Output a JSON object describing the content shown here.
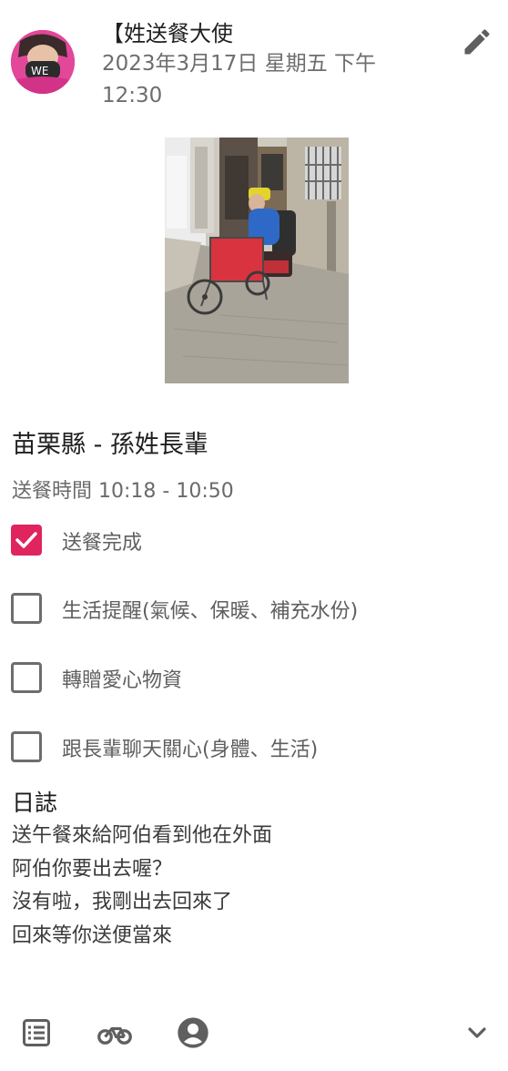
{
  "post": {
    "author": "【姓送餐大使",
    "timestamp": "2023年3月17日 星期五 下午 12:30",
    "avatar_text": "WE"
  },
  "content": {
    "title": "苗栗縣 - 孫姓長輩",
    "delivery_time": "送餐時間 10:18 - 10:50"
  },
  "checklist": [
    {
      "label": "送餐完成",
      "checked": true
    },
    {
      "label": "生活提醒(氣候、保暖、補充水份)",
      "checked": false
    },
    {
      "label": "轉贈愛心物資",
      "checked": false
    },
    {
      "label": "跟長輩聊天關心(身體、生活)",
      "checked": false
    }
  ],
  "log": {
    "heading": "日誌",
    "lines": [
      "送午餐來給阿伯看到他在外面",
      "阿伯你要出去喔？",
      "沒有啦，我剛出去回來了",
      "回來等你送便當來"
    ]
  },
  "icons": {
    "edit": "pencil-icon",
    "bottom": [
      "list-icon",
      "bicycle-icon",
      "account-icon",
      "chevron-down-icon"
    ]
  },
  "colors": {
    "accent": "#e0245e",
    "muted_text": "#6d6d6d",
    "icon_gray": "#5f5f5f"
  }
}
